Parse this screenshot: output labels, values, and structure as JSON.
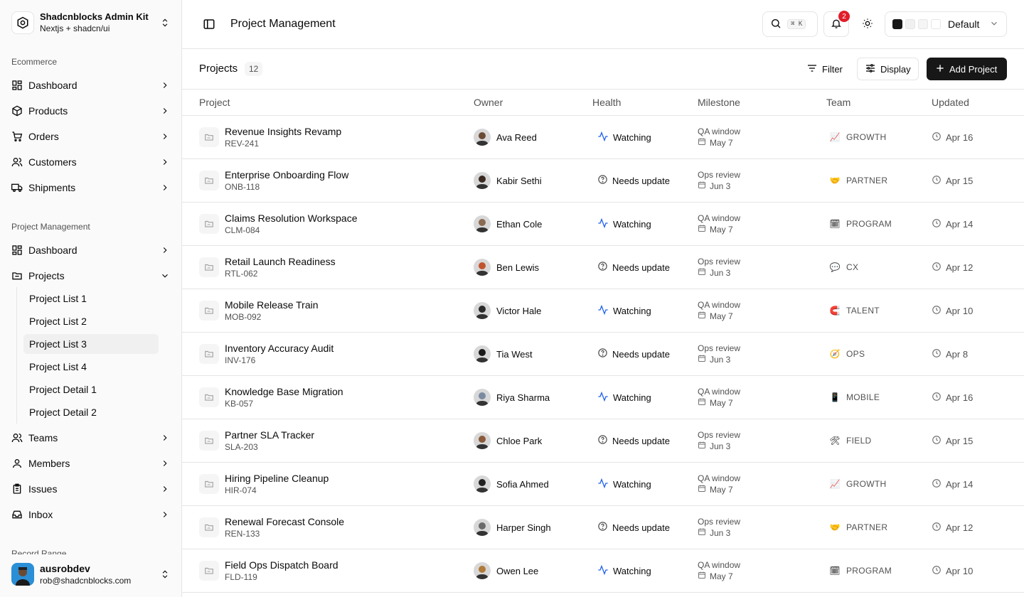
{
  "brand": {
    "title": "Shadcnblocks Admin Kit",
    "subtitle": "Nextjs + shadcn/ui"
  },
  "sidebar": {
    "groups": [
      {
        "label": "Ecommerce"
      },
      {
        "label": "Project Management"
      },
      {
        "label": "Record Range"
      }
    ],
    "ecommerce_items": [
      {
        "label": "Dashboard",
        "icon": "dashboard-icon"
      },
      {
        "label": "Products",
        "icon": "package-icon"
      },
      {
        "label": "Orders",
        "icon": "cart-icon"
      },
      {
        "label": "Customers",
        "icon": "users-icon"
      },
      {
        "label": "Shipments",
        "icon": "truck-icon"
      }
    ],
    "pm_items": [
      {
        "label": "Dashboard",
        "icon": "dashboard-icon"
      },
      {
        "label": "Projects",
        "icon": "folder-icon"
      }
    ],
    "project_sub_items": [
      {
        "label": "Project List 1"
      },
      {
        "label": "Project List 2"
      },
      {
        "label": "Project List 3",
        "active": true
      },
      {
        "label": "Project List 4"
      },
      {
        "label": "Project Detail 1"
      },
      {
        "label": "Project Detail 2"
      }
    ],
    "more_items": [
      {
        "label": "Teams",
        "icon": "users-icon"
      },
      {
        "label": "Members",
        "icon": "user-icon"
      },
      {
        "label": "Issues",
        "icon": "clipboard-icon"
      },
      {
        "label": "Inbox",
        "icon": "inbox-icon"
      }
    ]
  },
  "user": {
    "name": "ausrobdev",
    "email": "rob@shadcnblocks.com"
  },
  "header": {
    "title": "Project Management",
    "search_kbd": "⌘ K",
    "notification_count": "2",
    "theme_label": "Default"
  },
  "toolbar": {
    "title": "Projects",
    "count": "12",
    "filter_label": "Filter",
    "display_label": "Display",
    "add_label": "Add Project"
  },
  "columns": [
    "Project",
    "Owner",
    "Health",
    "Milestone",
    "Team",
    "Updated"
  ],
  "rows": [
    {
      "name": "Revenue Insights Revamp",
      "code": "REV-241",
      "owner": "Ava Reed",
      "health": "Watching",
      "milestone": "QA window",
      "date": "May 7",
      "team_emoji": "📈",
      "team": "GROWTH",
      "updated": "Apr 16"
    },
    {
      "name": "Enterprise Onboarding Flow",
      "code": "ONB-118",
      "owner": "Kabir Sethi",
      "health": "Needs update",
      "milestone": "Ops review",
      "date": "Jun 3",
      "team_emoji": "🤝",
      "team": "PARTNER",
      "updated": "Apr 15"
    },
    {
      "name": "Claims Resolution Workspace",
      "code": "CLM-084",
      "owner": "Ethan Cole",
      "health": "Watching",
      "milestone": "QA window",
      "date": "May 7",
      "team_emoji": "🗓",
      "team": "PROGRAM",
      "updated": "Apr 14"
    },
    {
      "name": "Retail Launch Readiness",
      "code": "RTL-062",
      "owner": "Ben Lewis",
      "health": "Needs update",
      "milestone": "Ops review",
      "date": "Jun 3",
      "team_emoji": "💬",
      "team": "CX",
      "updated": "Apr 12"
    },
    {
      "name": "Mobile Release Train",
      "code": "MOB-092",
      "owner": "Victor Hale",
      "health": "Watching",
      "milestone": "QA window",
      "date": "May 7",
      "team_emoji": "🧲",
      "team": "TALENT",
      "updated": "Apr 10"
    },
    {
      "name": "Inventory Accuracy Audit",
      "code": "INV-176",
      "owner": "Tia West",
      "health": "Needs update",
      "milestone": "Ops review",
      "date": "Jun 3",
      "team_emoji": "🧭",
      "team": "OPS",
      "updated": "Apr 8"
    },
    {
      "name": "Knowledge Base Migration",
      "code": "KB-057",
      "owner": "Riya Sharma",
      "health": "Watching",
      "milestone": "QA window",
      "date": "May 7",
      "team_emoji": "📱",
      "team": "MOBILE",
      "updated": "Apr 16"
    },
    {
      "name": "Partner SLA Tracker",
      "code": "SLA-203",
      "owner": "Chloe Park",
      "health": "Needs update",
      "milestone": "Ops review",
      "date": "Jun 3",
      "team_emoji": "🛠",
      "team": "FIELD",
      "updated": "Apr 15"
    },
    {
      "name": "Hiring Pipeline Cleanup",
      "code": "HIR-074",
      "owner": "Sofia Ahmed",
      "health": "Watching",
      "milestone": "QA window",
      "date": "May 7",
      "team_emoji": "📈",
      "team": "GROWTH",
      "updated": "Apr 14"
    },
    {
      "name": "Renewal Forecast Console",
      "code": "REN-133",
      "owner": "Harper Singh",
      "health": "Needs update",
      "milestone": "Ops review",
      "date": "Jun 3",
      "team_emoji": "🤝",
      "team": "PARTNER",
      "updated": "Apr 12"
    },
    {
      "name": "Field Ops Dispatch Board",
      "code": "FLD-119",
      "owner": "Owen Lee",
      "health": "Watching",
      "milestone": "QA window",
      "date": "May 7",
      "team_emoji": "🗓",
      "team": "PROGRAM",
      "updated": "Apr 10"
    }
  ],
  "colors": {
    "accent": "#171717",
    "watching": "#2563eb",
    "badge": "#e11d2a"
  }
}
